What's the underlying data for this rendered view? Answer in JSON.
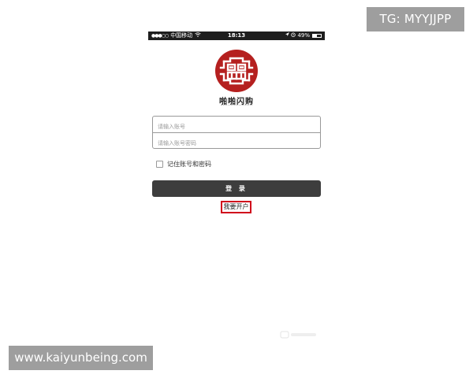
{
  "overlay": {
    "tg_label": "TG: MYYJJPP",
    "site_url": "www.kaiyunbeing.com"
  },
  "status_bar": {
    "carrier": "中国移动",
    "time": "18:13",
    "battery": "49%",
    "battery_level": 0.49
  },
  "logo": {
    "brand_name": "啪啪闪购",
    "color": "#b5201f"
  },
  "login_form": {
    "account_placeholder": "请输入账号",
    "password_placeholder": "请输入账号密码",
    "remember_label": "记住账号和密码",
    "remember_checked": false,
    "login_button_label": "登 录",
    "open_account_label": "我要开户"
  },
  "colors": {
    "button_bg": "#3d3d3d",
    "highlight_border": "#d0021b"
  }
}
